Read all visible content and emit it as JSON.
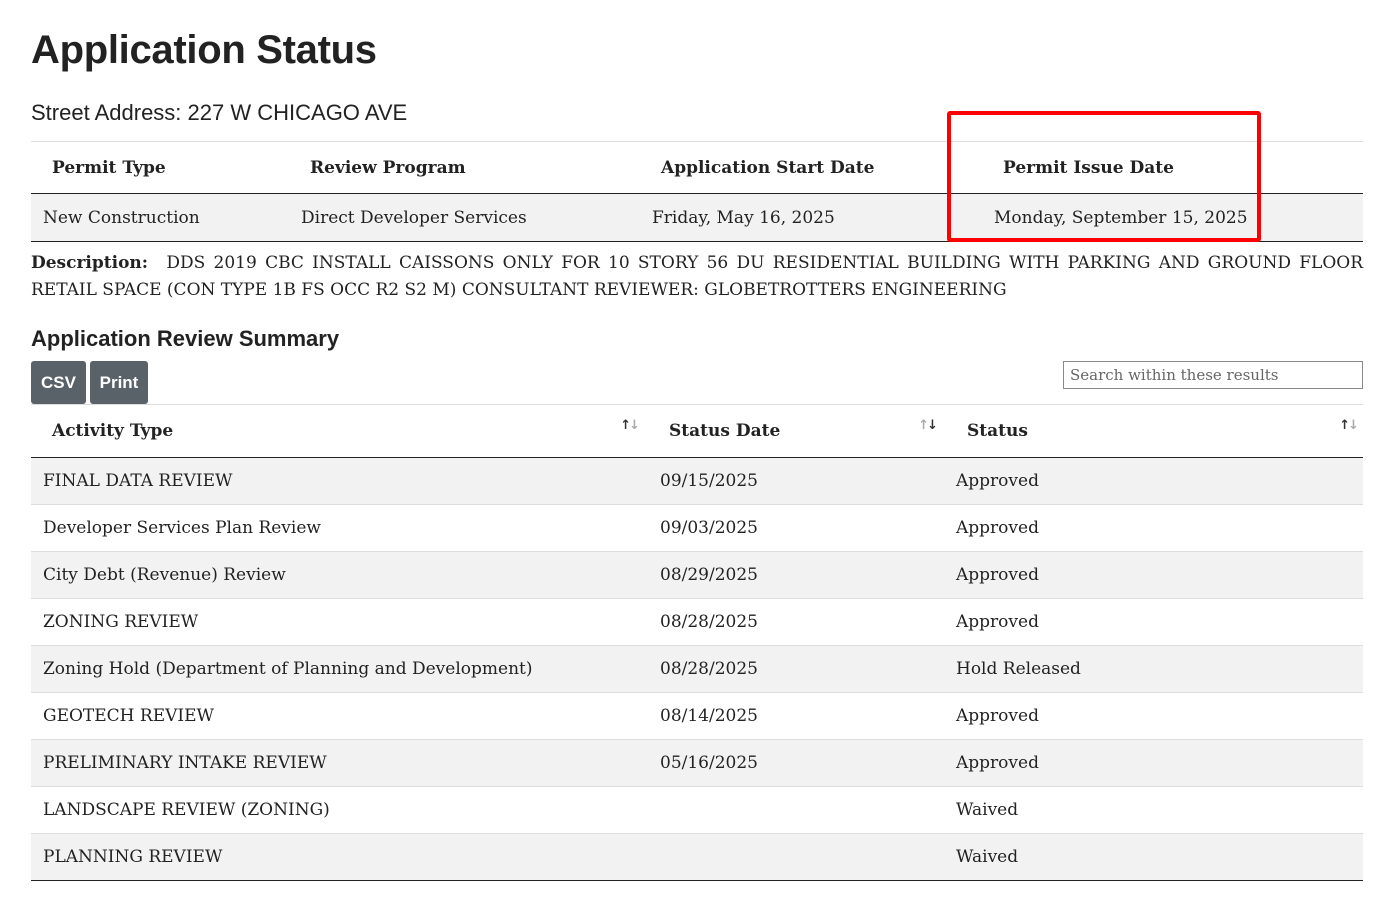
{
  "page": {
    "title": "Application Status",
    "address_label": "Street Address:",
    "address_value": "227 W CHICAGO AVE"
  },
  "permit": {
    "headers": [
      "Permit Type",
      "Review Program",
      "Application Start Date",
      "Permit Issue Date"
    ],
    "row": [
      "New Construction",
      "Direct Developer Services",
      "Friday, May 16, 2025",
      "Monday, September 15, 2025"
    ]
  },
  "description": {
    "label": "Description:",
    "text": "DDS 2019 CBC INSTALL CAISSONS ONLY FOR 10 STORY 56 DU RESIDENTIAL BUILDING WITH PARKING AND GROUND FLOOR RETAIL SPACE (CON TYPE 1B FS OCC R2 S2 M) CONSULTANT REVIEWER: GLOBETROTTERS ENGINEERING"
  },
  "summary": {
    "title": "Application Review Summary",
    "csv_label": "CSV",
    "print_label": "Print",
    "search_placeholder": "Search within these results",
    "headers": [
      "Activity Type",
      "Status Date",
      "Status"
    ],
    "rows": [
      [
        "FINAL DATA REVIEW",
        "09/15/2025",
        "Approved"
      ],
      [
        "Developer Services Plan Review",
        "09/03/2025",
        "Approved"
      ],
      [
        "City Debt (Revenue) Review",
        "08/29/2025",
        "Approved"
      ],
      [
        "ZONING REVIEW",
        "08/28/2025",
        "Approved"
      ],
      [
        "Zoning Hold (Department of Planning and Development)",
        "08/28/2025",
        "Hold Released"
      ],
      [
        "GEOTECH REVIEW",
        "08/14/2025",
        "Approved"
      ],
      [
        "PRELIMINARY INTAKE REVIEW",
        "05/16/2025",
        "Approved"
      ],
      [
        "LANDSCAPE REVIEW (ZONING)",
        "",
        "Waived"
      ],
      [
        "PLANNING REVIEW",
        "",
        "Waived"
      ]
    ]
  },
  "colors": {
    "highlight": "#ff0000",
    "button_bg": "#5a6269",
    "stripe": "#f2f2f2"
  }
}
